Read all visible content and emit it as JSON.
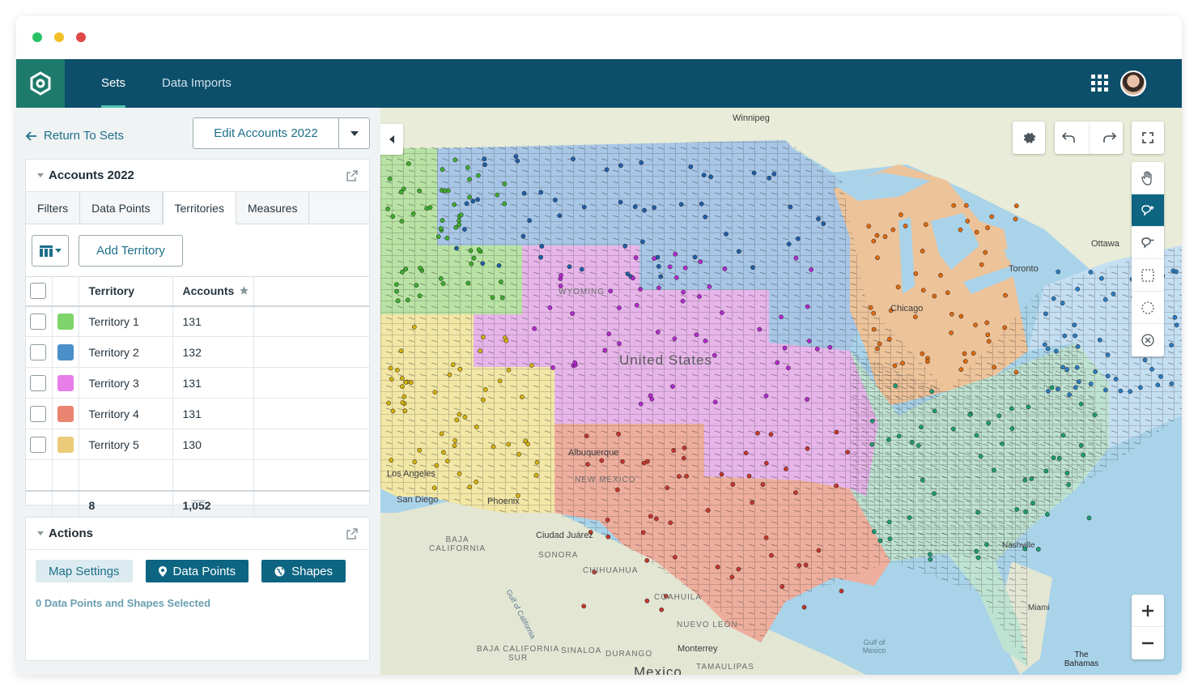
{
  "nav": {
    "tabs": [
      {
        "label": "Sets",
        "active": true
      },
      {
        "label": "Data Imports",
        "active": false
      }
    ]
  },
  "left": {
    "return_label": "Return To Sets",
    "edit_label": "Edit Accounts 2022",
    "set_card": {
      "title": "Accounts 2022",
      "tabs": [
        "Filters",
        "Data Points",
        "Territories",
        "Measures"
      ],
      "active_tab": "Territories",
      "add_territory_label": "Add Territory",
      "columns": [
        "Territory",
        "Accounts"
      ],
      "rows": [
        {
          "name": "Territory 1",
          "accounts": "131",
          "color": "#7ed46a"
        },
        {
          "name": "Territory 2",
          "accounts": "132",
          "color": "#4a8fc8"
        },
        {
          "name": "Territory 3",
          "accounts": "131",
          "color": "#e87ee8"
        },
        {
          "name": "Territory 4",
          "accounts": "131",
          "color": "#ea8470"
        },
        {
          "name": "Territory 5",
          "accounts": "130",
          "color": "#ebcb79"
        }
      ],
      "total": {
        "count": "8",
        "accounts": "1,052"
      }
    },
    "actions_card": {
      "title": "Actions",
      "map_settings_label": "Map Settings",
      "data_points_label": "Data Points",
      "shapes_label": "Shapes",
      "selection_text": "0 Data Points and Shapes Selected"
    }
  },
  "map": {
    "labels": {
      "winnipeg": "Winnipeg",
      "ottawa": "Ottawa",
      "toronto": "Toronto",
      "chicago": "Chicago",
      "united_states": "United States",
      "wyoming": "WYOMING",
      "albuquerque": "Albuquerque",
      "new_mexico": "NEW MEXICO",
      "los_angeles": "Los Angeles",
      "san_diego": "San Diego",
      "phoenix": "Phoenix",
      "ciudad_juarez": "Ciudad Juárez",
      "baja_california": "BAJA CALIFORNIA",
      "sonora": "SONORA",
      "chihuahua": "CHIHUAHUA",
      "coahuila": "COAHUILA",
      "nuevo_leon": "NUEVO LEÓN",
      "baja_california_sur": "BAJA CALIFORNIA SUR",
      "sinaloa": "SINALOA",
      "durango": "DURANGO",
      "tamaulipas": "TAMAULIPAS",
      "monterrey": "Monterrey",
      "mexico": "Mexico",
      "gulf_of_mexico": "Gulf of Mexico",
      "gulf_of_california": "Gulf of California",
      "the_bahamas": "The Bahamas",
      "miami": "Miami",
      "nashville": "Nashville"
    },
    "territory_colors": {
      "northwest": "#b8e3a4",
      "north": "#a8c6e6",
      "central": "#e7b5ea",
      "southwest": "#f3e7a6",
      "south": "#eeae9d",
      "midwest": "#edc39a",
      "southeast": "#bfe3d2",
      "northeast": "#c4def2"
    }
  }
}
